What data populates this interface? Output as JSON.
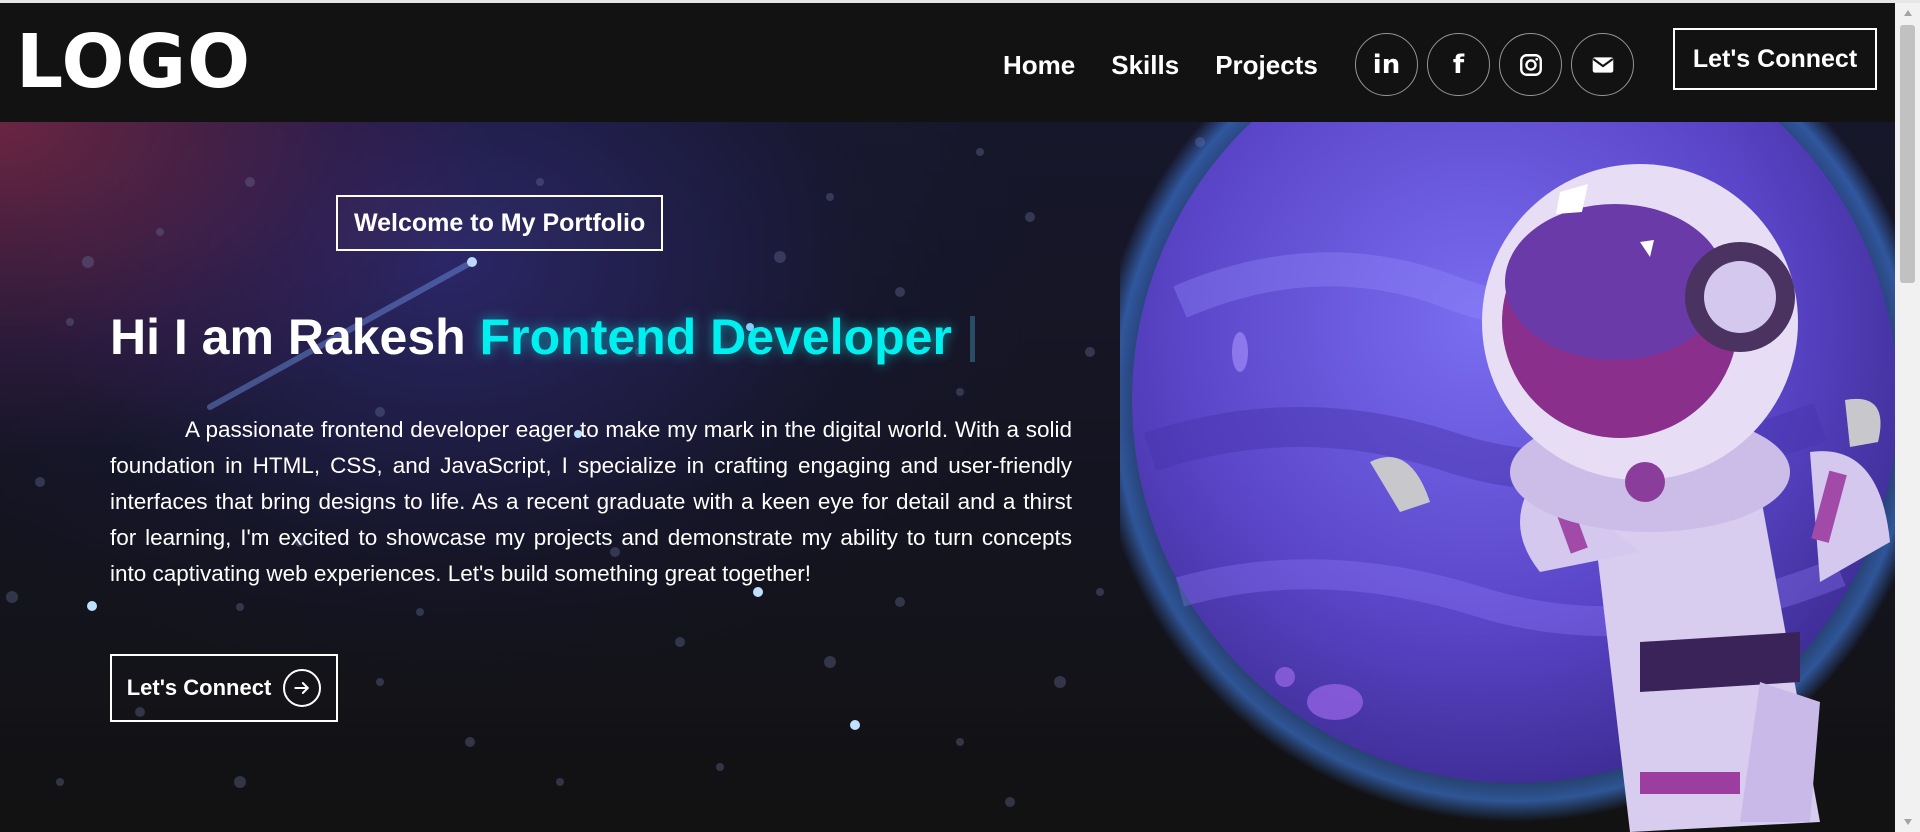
{
  "navbar": {
    "logo": "LOGO",
    "links": [
      "Home",
      "Skills",
      "Projects"
    ],
    "socials": [
      {
        "name": "linkedin-icon",
        "glyph": "in"
      },
      {
        "name": "facebook-icon",
        "glyph": "f"
      },
      {
        "name": "instagram-icon",
        "glyph": ""
      },
      {
        "name": "email-icon",
        "glyph": ""
      }
    ],
    "connect_label": "Let's Connect"
  },
  "hero": {
    "tagline": "Welcome to My Portfolio",
    "headline_prefix": "Hi I am Rakesh ",
    "headline_accent": "Frontend Developer",
    "description": "A passionate frontend developer eager to make my mark in the digital world. With a solid foundation in HTML, CSS, and JavaScript, I specialize in crafting engaging and user-friendly interfaces that bring designs to life. As a recent graduate with a keen eye for detail and a thirst for learning, I'm excited to showcase my projects and demonstrate my ability to turn concepts into captivating web experiences. Let's build something great together!",
    "connect_label": "Let's Connect"
  },
  "colors": {
    "accent": "#00f0f0",
    "background": "#121212",
    "planet": "#6a4fd6"
  }
}
